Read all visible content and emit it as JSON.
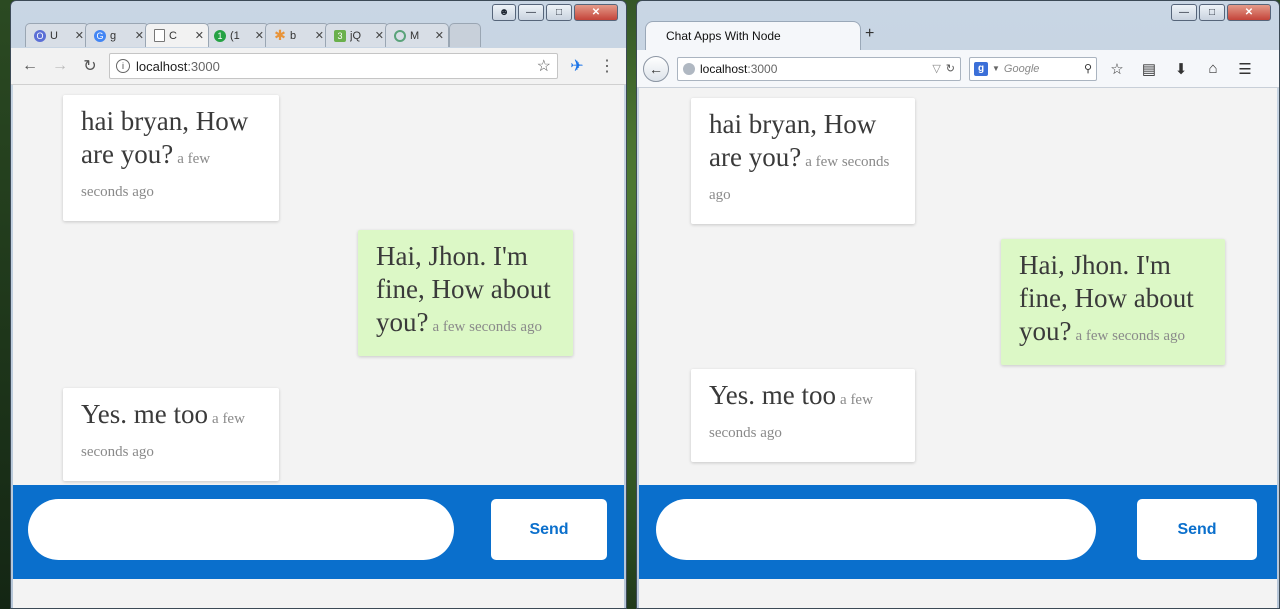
{
  "chrome_window": {
    "tabs": [
      {
        "label": "U",
        "icon": "opera-icon",
        "color": "#5b6fd6"
      },
      {
        "label": "g",
        "icon": "google-icon",
        "color": "#4285f4"
      },
      {
        "label": "C",
        "icon": "page-icon",
        "color": "#777777"
      },
      {
        "label": "(1",
        "icon": "whatsapp-icon",
        "color": "#25a244"
      },
      {
        "label": "b",
        "icon": "asterisk-icon",
        "color": "#e8943a"
      },
      {
        "label": "jQ",
        "icon": "badge-icon",
        "color": "#6ab04c"
      },
      {
        "label": "M",
        "icon": "clock-icon",
        "color": "#5aa37a"
      }
    ],
    "address": {
      "host": "localhost",
      "port": ":3000"
    }
  },
  "firefox_window": {
    "tab_title": "Chat Apps With Node",
    "address": {
      "host": "localhost",
      "port": ":3000"
    },
    "search_placeholder": "Google"
  },
  "chat": {
    "messages": [
      {
        "direction": "in",
        "text": "hai bryan, How are you?",
        "time": "a few seconds ago"
      },
      {
        "direction": "out",
        "text": "Hai, Jhon. I'm fine, How about you?",
        "time": "a few seconds ago"
      },
      {
        "direction": "in",
        "text": "Yes. me too",
        "time": "a few seconds ago"
      }
    ],
    "send_label": "Send",
    "colors": {
      "composer": "#0a6fcc",
      "outgoing": "#dcf8c6",
      "incoming": "#ffffff",
      "page": "#f3f3f3"
    }
  }
}
